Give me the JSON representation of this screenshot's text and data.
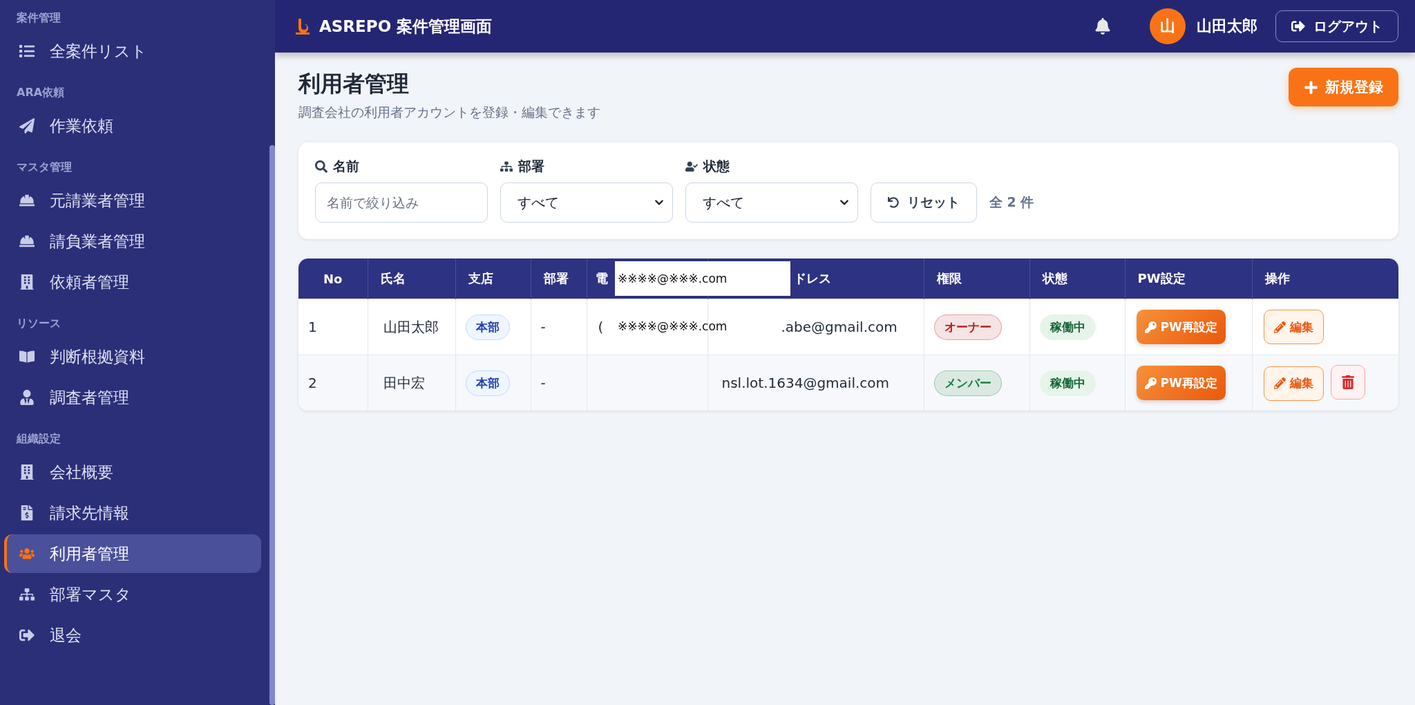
{
  "app": {
    "title": "ASREPO 案件管理画面",
    "user_initial": "山",
    "user_name": "山田太郎",
    "logout": "ログアウト"
  },
  "sidebar": [
    {
      "heading": "案件管理",
      "items": [
        {
          "label": "全案件リスト",
          "selected": false
        }
      ]
    },
    {
      "heading": "ARA依頼",
      "items": [
        {
          "label": "作業依頼",
          "selected": false
        }
      ]
    },
    {
      "heading": "マスタ管理",
      "items": [
        {
          "label": "元請業者管理",
          "selected": false
        },
        {
          "label": "請負業者管理",
          "selected": false
        },
        {
          "label": "依頼者管理",
          "selected": false
        }
      ]
    },
    {
      "heading": "リソース",
      "items": [
        {
          "label": "判断根拠資料",
          "selected": false
        },
        {
          "label": "調査者管理",
          "selected": false
        }
      ]
    },
    {
      "heading": "組織設定",
      "items": [
        {
          "label": "会社概要",
          "selected": false
        },
        {
          "label": "請求先情報",
          "selected": false
        },
        {
          "label": "利用者管理",
          "selected": true
        },
        {
          "label": "部署マスタ",
          "selected": false
        },
        {
          "label": "退会",
          "selected": false
        }
      ]
    }
  ],
  "page": {
    "title": "利用者管理",
    "subtitle": "調査会社の利用者アカウントを登録・編集できます",
    "new_button": "新規登録"
  },
  "filters": {
    "name": {
      "label": "名前",
      "placeholder": "名前で絞り込み"
    },
    "department": {
      "label": "部署",
      "value": "すべて"
    },
    "status": {
      "label": "状態",
      "value": "すべて"
    },
    "reset": "リセット",
    "count": "全 2 件"
  },
  "table": {
    "columns": [
      "No",
      "氏名",
      "支店",
      "部署",
      "電",
      "ドレス",
      "権限",
      "状態",
      "PW設定",
      "操作"
    ],
    "header_mask": "※※※※@※※※.com",
    "rows": [
      {
        "no": "1",
        "name": "山田太郎",
        "branch": "本部",
        "department": "-",
        "phone": "(",
        "phone_mask": "※※※※@※※※.com",
        "email": ".abe@gmail.com",
        "role": {
          "label": "オーナー",
          "color": "#b91c1c"
        },
        "status": "稼働中",
        "pw": "PW再設定",
        "edit": "編集",
        "deletable": false
      },
      {
        "no": "2",
        "name": "田中宏",
        "branch": "本部",
        "department": "-",
        "phone": "",
        "email": "nsl.lot.1634@gmail.com",
        "role": {
          "label": "メンバー",
          "color": "#15803d"
        },
        "status": "稼働中",
        "pw": "PW再設定",
        "edit": "編集",
        "deletable": true
      }
    ]
  }
}
